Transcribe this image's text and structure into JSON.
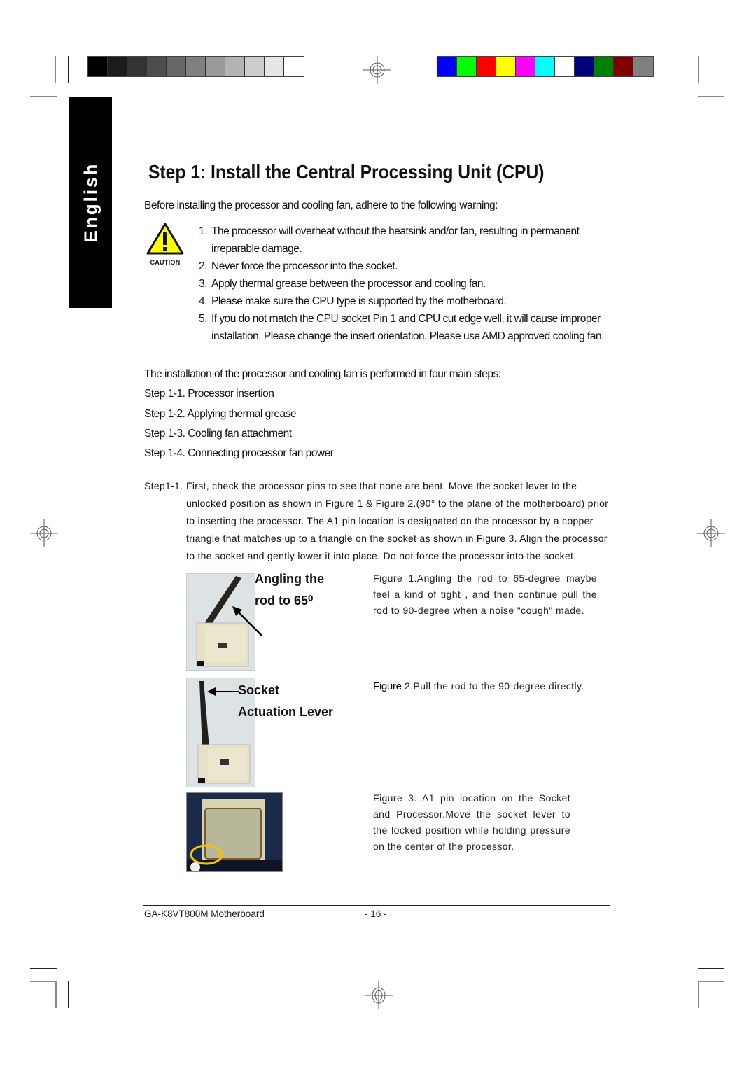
{
  "print_marks": {
    "grayscale_swatches": [
      "#000000",
      "#1c1c1c",
      "#333333",
      "#4d4d4d",
      "#666666",
      "#808080",
      "#999999",
      "#b3b3b3",
      "#cccccc",
      "#e6e6e6",
      "#ffffff"
    ],
    "color_swatches": [
      "#0000ff",
      "#00ff00",
      "#ff0000",
      "#ffff00",
      "#ff00ff",
      "#00ffff",
      "#ffffff",
      "#000080",
      "#008000",
      "#800000",
      "#808080"
    ],
    "registration_icon": "crosshair-target-icon"
  },
  "language_tab": {
    "label": "English"
  },
  "heading": {
    "title": "Step 1: Install the Central Processing Unit (CPU)"
  },
  "intro": {
    "text": "Before installing the processor and cooling fan, adhere to the following warning:"
  },
  "caution": {
    "icon": "caution-triangle-icon",
    "label": "CAUTION",
    "color": "#ffff00"
  },
  "warnings": [
    {
      "num": "1.",
      "text": "The processor will overheat without the heatsink and/or fan, resulting in permanent irreparable damage."
    },
    {
      "num": "2.",
      "text": "Never force the processor into the socket."
    },
    {
      "num": "3.",
      "text": "Apply thermal grease between the processor and cooling fan."
    },
    {
      "num": "4.",
      "text": "Please make sure the CPU type is supported by the motherboard."
    },
    {
      "num": "5.",
      "text": "If you do not match the CPU socket Pin 1 and CPU cut edge well, it will cause improper installation.  Please change the insert orientation. Please use AMD approved cooling fan."
    }
  ],
  "steps_intro": "The installation of the processor and cooling fan is performed in four main steps:",
  "steps": [
    "Step 1-1. Processor insertion",
    "Step 1-2. Applying thermal grease",
    "Step 1-3. Cooling fan attachment",
    "Step 1-4. Connecting processor fan power"
  ],
  "step_detail": {
    "label": "Step1-1.",
    "lines": [
      "First, check the processor pins to see that none are bent.  Move the socket lever to the",
      "unlocked position as shown in Figure 1 & Figure 2.(90° to the plane of the motherboard) prior",
      "to inserting the processor.  The A1 pin location is designated on the processor by a copper",
      "triangle that matches up to a triangle on the socket as shown in Figure 3.  Align the processor",
      "to the socket and gently lower it into place.  Do not force the processor into the socket."
    ]
  },
  "figures": [
    {
      "label_lines": [
        "Angling the",
        "rod to 65⁰"
      ],
      "caption": "Figure 1.Angling the rod to 65-degree maybe feel a kind of tight , and then continue pull the rod to 90-degree when a noise \"cough\" made."
    },
    {
      "label_lines": [
        "Socket",
        "Actuation Lever"
      ],
      "caption_prefix": "Figure",
      "caption": " 2.Pull the rod to the 90-degree directly."
    },
    {
      "caption": "Figure 3. A1 pin location on the Socket and Processor.Move the socket lever to the locked position while holding pressure on the center of the processor.",
      "highlight_color": "#f5c400"
    }
  ],
  "footer": {
    "product": "GA-K8VT800M Motherboard",
    "page": "- 16 -"
  }
}
